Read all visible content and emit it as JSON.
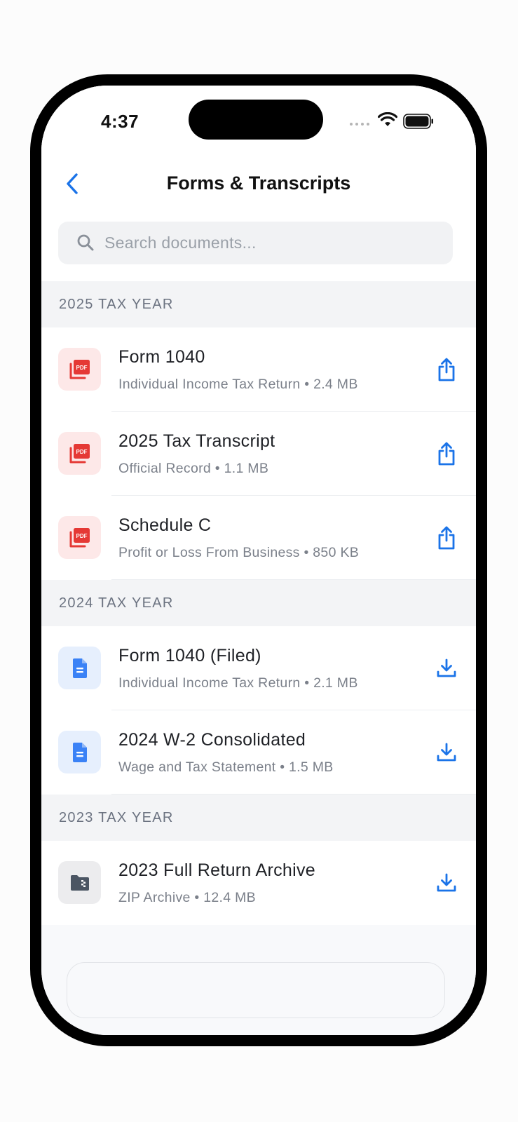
{
  "status": {
    "time": "4:37"
  },
  "nav": {
    "title": "Forms & Transcripts"
  },
  "search": {
    "placeholder": "Search documents..."
  },
  "sections": [
    {
      "header": "2025 TAX YEAR",
      "items": [
        {
          "title": "Form 1040",
          "subtitle": "Individual Income Tax Return • 2.4 MB",
          "icon": "pdf-icon",
          "action": "share-icon"
        },
        {
          "title": "2025 Tax Transcript",
          "subtitle": "Official Record • 1.1 MB",
          "icon": "pdf-icon",
          "action": "share-icon"
        },
        {
          "title": "Schedule C",
          "subtitle": "Profit or Loss From Business • 850 KB",
          "icon": "pdf-icon",
          "action": "share-icon"
        }
      ]
    },
    {
      "header": "2024 TAX YEAR",
      "items": [
        {
          "title": "Form 1040 (Filed)",
          "subtitle": "Individual Income Tax Return • 2.1 MB",
          "icon": "document-icon",
          "action": "download-icon"
        },
        {
          "title": "2024 W-2 Consolidated",
          "subtitle": "Wage and Tax Statement • 1.5 MB",
          "icon": "document-icon",
          "action": "download-icon"
        }
      ]
    },
    {
      "header": "2023 TAX YEAR",
      "items": [
        {
          "title": "2023 Full Return Archive",
          "subtitle": "ZIP Archive • 12.4 MB",
          "icon": "zip-folder-icon",
          "action": "download-icon"
        }
      ]
    }
  ],
  "colors": {
    "accent": "#1a73e8",
    "pdf_red": "#e53935",
    "doc_blue": "#3b82f6",
    "zip_gray": "#4b5563"
  }
}
